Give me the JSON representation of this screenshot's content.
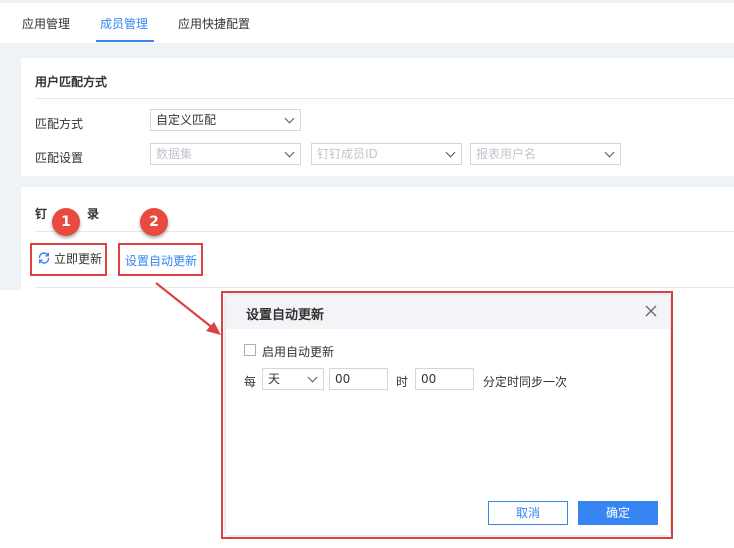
{
  "tabs": [
    "应用管理",
    "成员管理",
    "应用快捷配置"
  ],
  "match_card": {
    "title": "用户匹配方式",
    "method_label": "匹配方式",
    "method_value": "自定义匹配",
    "settings_label": "匹配设置",
    "dataset_placeholder": "数据集",
    "dingtalk_id_placeholder": "钉钉成员ID",
    "report_user_placeholder": "报表用户名"
  },
  "sync_card": {
    "title_before": "钉",
    "title_after": "录",
    "refresh_label": "立即更新",
    "auto_update_label": "设置自动更新"
  },
  "callouts": [
    "1",
    "2"
  ],
  "dialog": {
    "title": "设置自动更新",
    "enable_label": "启用自动更新",
    "every_label": "每",
    "period_value": "天",
    "hour_value": "00",
    "hour_label": "时",
    "minute_value": "00",
    "suffix_label": "分定时同步一次",
    "cancel_label": "取消",
    "ok_label": "确定"
  },
  "colors": {
    "accent": "#3685f2",
    "annotation": "#e04040"
  },
  "icons": [
    "refresh-icon",
    "close-icon",
    "chevron-down-icon",
    "arrow-annotation"
  ]
}
